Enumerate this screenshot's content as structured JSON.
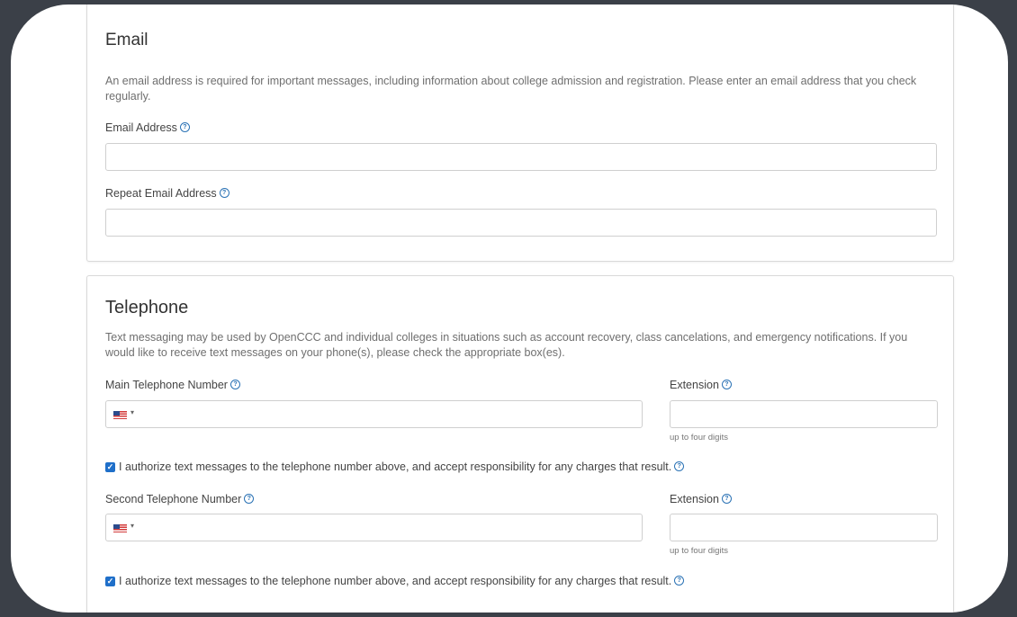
{
  "email_section": {
    "title": "Email",
    "description": "An email address is required for important messages, including information about college admission and registration. Please enter an email address that you check regularly.",
    "email_label": "Email Address",
    "email_value": "",
    "repeat_label": "Repeat Email Address",
    "repeat_value": ""
  },
  "telephone_section": {
    "title": "Telephone",
    "description": "Text messaging may be used by OpenCCC and individual colleges in situations such as account recovery, class cancelations, and emergency notifications. If you would like to receive text messages on your phone(s), please check the appropriate box(es).",
    "main_label": "Main Telephone Number",
    "main_extension_label": "Extension",
    "main_extension_hint": "up to four digits",
    "main_authorize_text": "I authorize text messages to the telephone number above, and accept responsibility for any charges that result.",
    "main_authorize_checked": true,
    "second_label": "Second Telephone Number",
    "second_extension_label": "Extension",
    "second_extension_hint": "up to four digits",
    "second_authorize_text": "I authorize text messages to the telephone number above, and accept responsibility for any charges that result.",
    "second_authorize_checked": true,
    "country_flag_icon": "us-flag-icon",
    "help_icon": "question-circle-icon",
    "check_glyph": "✓",
    "help_glyph": "?",
    "caret_glyph": "▾"
  },
  "colors": {
    "background": "#3b4048",
    "checkbox": "#1f6fc9",
    "help_icon": "#2a72b5"
  }
}
